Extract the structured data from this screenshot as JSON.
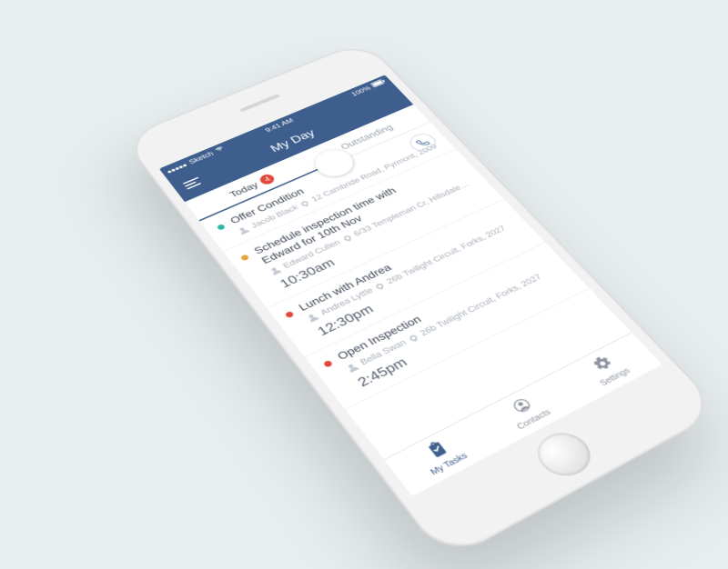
{
  "statusbar": {
    "carrier": "Sketch",
    "time": "9:41 AM",
    "battery": "100%"
  },
  "header": {
    "title": "My Day"
  },
  "tabs": {
    "today": "Today",
    "today_badge": "4",
    "outstanding": "Outstanding"
  },
  "colors": {
    "teal": "#2bb6a6",
    "amber": "#e9a23b",
    "red": "#e1473d",
    "nav": "#3e5f8e"
  },
  "tasks": [
    {
      "dot_color": "teal",
      "title": "Offer Condition",
      "contact": "Jacob Black",
      "address": "12 Cambride Road, Pyrmont, 2009",
      "has_call": true
    },
    {
      "dot_color": "amber",
      "title": "Schedule inspection time with Edward for 10th Nov",
      "contact": "Edward Cullen",
      "address": "6/33 Templeman Cr, Hillsdale…",
      "time": "10:30am"
    },
    {
      "dot_color": "red",
      "title": "Lunch with Andrea",
      "contact": "Andrea Lyttle",
      "address": "26b Twilight Circuit, Forks, 2027",
      "time": "12:30pm"
    },
    {
      "dot_color": "red",
      "title": "Open Inspection",
      "contact": "Bella Swan",
      "address": "26b Twilight Circuit, Forks, 2027",
      "time": "2:45pm"
    }
  ],
  "tabbar": {
    "tasks": "My Tasks",
    "contacts": "Contacts",
    "settings": "Settings"
  }
}
